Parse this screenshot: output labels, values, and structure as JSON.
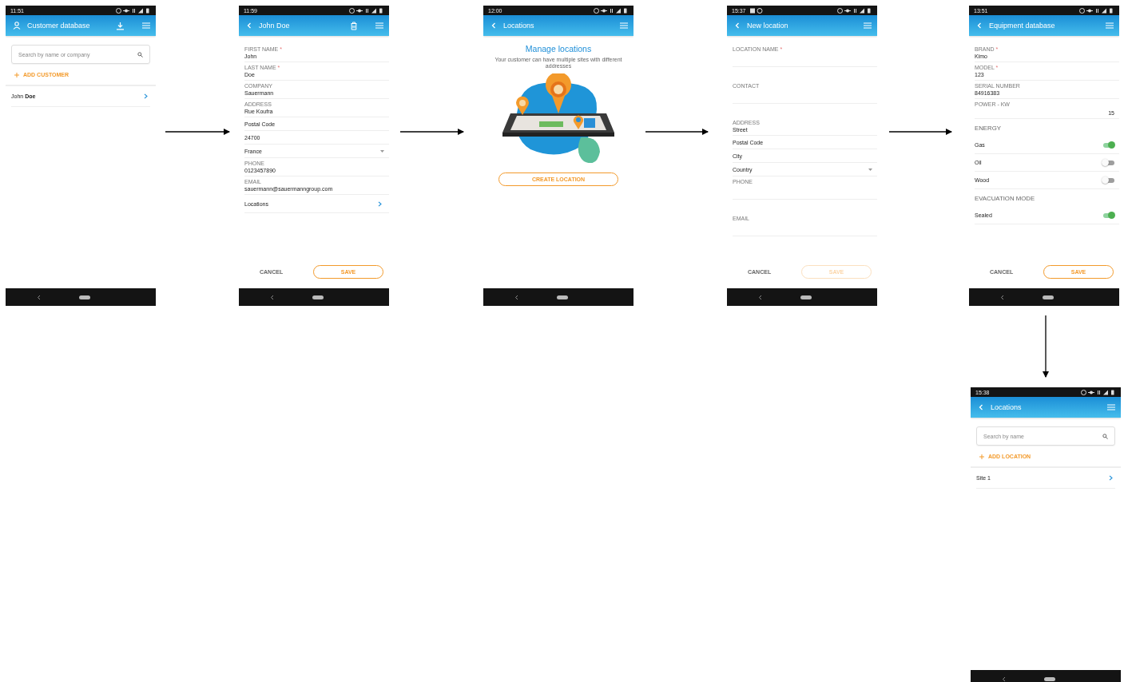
{
  "screens": [
    {
      "kind": "customer_list",
      "time": "11:51",
      "title": "Customer database",
      "search": {
        "placeholder": "Search by name or company"
      },
      "add_label": "ADD CUSTOMER",
      "items": [
        "John **Doe**"
      ]
    },
    {
      "kind": "customer_form",
      "time": "11:59",
      "title": "John Doe",
      "fields": [
        {
          "kind": "field",
          "label": "FIRST NAME",
          "mark": "*",
          "value": "John"
        },
        {
          "kind": "field",
          "label": "LAST NAME",
          "mark": "*",
          "value": "Doe"
        },
        {
          "kind": "field",
          "label": "COMPANY",
          "value": "Sauermann"
        },
        {
          "kind": "field",
          "label": "ADDRESS",
          "value": "Rue Koufra"
        },
        {
          "kind": "line",
          "value": "Postal Code"
        },
        {
          "kind": "line",
          "value": "24700"
        },
        {
          "kind": "select",
          "value": "France"
        },
        {
          "kind": "field",
          "label": "PHONE",
          "value": "0123457890"
        },
        {
          "kind": "field",
          "label": "EMAIL",
          "value": "sauermann@sauermanngroup.com"
        },
        {
          "kind": "link",
          "value": "Locations"
        }
      ],
      "cancel": "CANCEL",
      "save": {
        "label": "SAVE",
        "disabled": false
      }
    },
    {
      "kind": "intro",
      "time": "12:00",
      "title": "Locations",
      "heading": "Manage locations",
      "text": "Your customer can have multiple sites with different addresses",
      "button": "CREATE LOCATION"
    },
    {
      "kind": "location_form",
      "time": "15:37",
      "notification_icons": true,
      "title": "New location",
      "fields": [
        {
          "kind": "field",
          "label": "LOCATION NAME",
          "mark": "*"
        },
        {
          "kind": "field",
          "label": "CONTACT"
        },
        {
          "kind": "field",
          "label": "ADDRESS",
          "value": "Street"
        },
        {
          "kind": "line",
          "value": "Postal Code"
        },
        {
          "kind": "line",
          "value": "City"
        },
        {
          "kind": "select",
          "value": "Country"
        },
        {
          "kind": "field",
          "label": "PHONE"
        },
        {
          "kind": "field",
          "label": "EMAIL"
        }
      ],
      "cancel": "CANCEL",
      "save": {
        "label": "SAVE",
        "disabled": true
      }
    },
    {
      "kind": "equipment_form",
      "time": "13:51",
      "title": "Equipment database",
      "fields": [
        {
          "kind": "field",
          "label": "BRAND",
          "mark": "*",
          "value": "Kimo"
        },
        {
          "kind": "field",
          "label": "MODEL",
          "mark": "*",
          "value": "123"
        },
        {
          "kind": "field",
          "label": "SERIAL NUMBER",
          "value": "84916383"
        },
        {
          "kind": "number",
          "label": "POWER - KW",
          "value": "15"
        },
        {
          "kind": "section",
          "value": "ENERGY"
        },
        {
          "kind": "toggle",
          "value": "Gas",
          "on": true
        },
        {
          "kind": "toggle",
          "value": "Oil",
          "on": false
        },
        {
          "kind": "toggle",
          "value": "Wood",
          "on": false
        },
        {
          "kind": "section",
          "value": "EVACUATION MODE"
        },
        {
          "kind": "toggle",
          "value": "Sealed",
          "on": true
        }
      ],
      "cancel": "CANCEL",
      "save": {
        "label": "SAVE",
        "disabled": false
      }
    },
    {
      "kind": "location_list",
      "time": "15:38",
      "title": "Locations",
      "search": {
        "placeholder": "Search by name"
      },
      "add_label": "ADD LOCATION",
      "items": [
        "Site 1"
      ]
    }
  ]
}
